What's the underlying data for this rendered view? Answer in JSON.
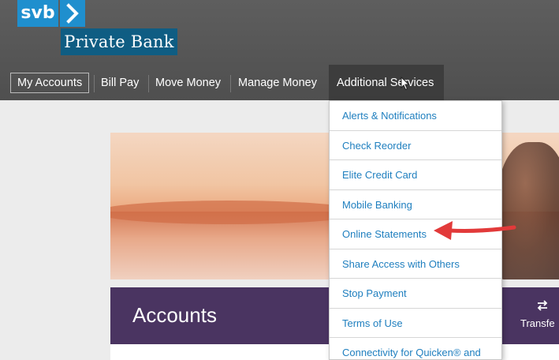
{
  "logo": {
    "short": "svb",
    "bank": "Private Bank"
  },
  "nav": {
    "items": [
      {
        "label": "My Accounts"
      },
      {
        "label": "Bill Pay"
      },
      {
        "label": "Move Money"
      },
      {
        "label": "Manage Money"
      },
      {
        "label": "Additional Services"
      }
    ]
  },
  "dropdown": {
    "items": [
      {
        "label": "Alerts & Notifications"
      },
      {
        "label": "Check Reorder"
      },
      {
        "label": "Elite Credit Card"
      },
      {
        "label": "Mobile Banking"
      },
      {
        "label": "Online Statements"
      },
      {
        "label": "Share Access with Others"
      },
      {
        "label": "Stop Payment"
      },
      {
        "label": "Terms of Use"
      },
      {
        "label": "Connectivity for Quicken® and"
      }
    ]
  },
  "accounts": {
    "title": "Accounts",
    "transfer_label": "Transfe"
  },
  "icons": {
    "chevron": "chevron-right-icon",
    "cursor": "mouse-pointer-icon",
    "transfer": "transfer-arrows-icon",
    "annotation": "red-arrow-icon"
  },
  "colors": {
    "brand_blue": "#1f8fce",
    "brand_dark": "#0f5d83",
    "header_bg": "#555555",
    "accounts_bar": "#4a3461",
    "link": "#1f7fbf",
    "annotation_arrow": "#e23a3a"
  }
}
